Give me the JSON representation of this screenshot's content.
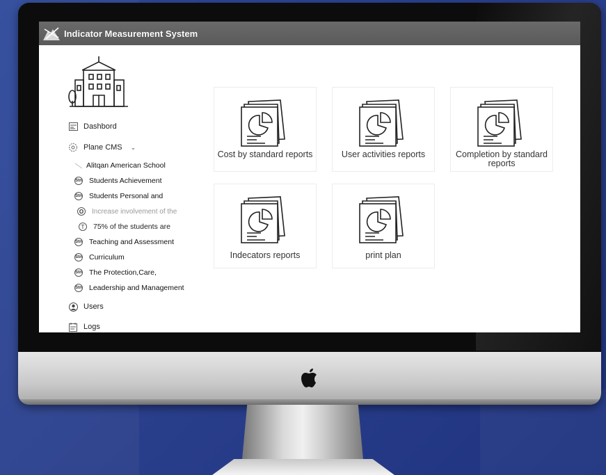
{
  "app": {
    "title": "Indicator Measurement System"
  },
  "sidebar": {
    "items": [
      {
        "label": "Dashbord",
        "icon": "dashboard-icon"
      },
      {
        "label": "Plane CMS",
        "icon": "settings-icon",
        "expand": "⌄"
      },
      {
        "label": "Alitqan American School",
        "icon": "school-icon"
      },
      {
        "label": "Students Achievement",
        "icon": "badge-icon",
        "badge": "Stn"
      },
      {
        "label": "Students Personal and",
        "icon": "badge-icon",
        "badge": "Stn"
      },
      {
        "label": "Increase involvement of the",
        "icon": "target-icon",
        "badge": "O"
      },
      {
        "label": "75% of the students are",
        "icon": "task-icon",
        "badge": "T"
      },
      {
        "label": "Teaching and Assessment",
        "icon": "badge-icon",
        "badge": "Stn"
      },
      {
        "label": "Curriculum",
        "icon": "badge-icon",
        "badge": "Stn"
      },
      {
        "label": "The Protection,Care,",
        "icon": "badge-icon",
        "badge": "Stn"
      },
      {
        "label": "Leadership and Management",
        "icon": "badge-icon",
        "badge": "Stn"
      },
      {
        "label": "Users",
        "icon": "user-icon"
      },
      {
        "label": "Logs",
        "icon": "logs-icon"
      }
    ]
  },
  "reports": [
    {
      "label": "Cost by standard reports"
    },
    {
      "label": "User activities reports"
    },
    {
      "label": "Completion by standard reports"
    },
    {
      "label": "Indecators reports"
    },
    {
      "label": "print plan"
    }
  ],
  "colors": {
    "titlebar": "#5f5f5f",
    "background": "#2a3f8c"
  }
}
